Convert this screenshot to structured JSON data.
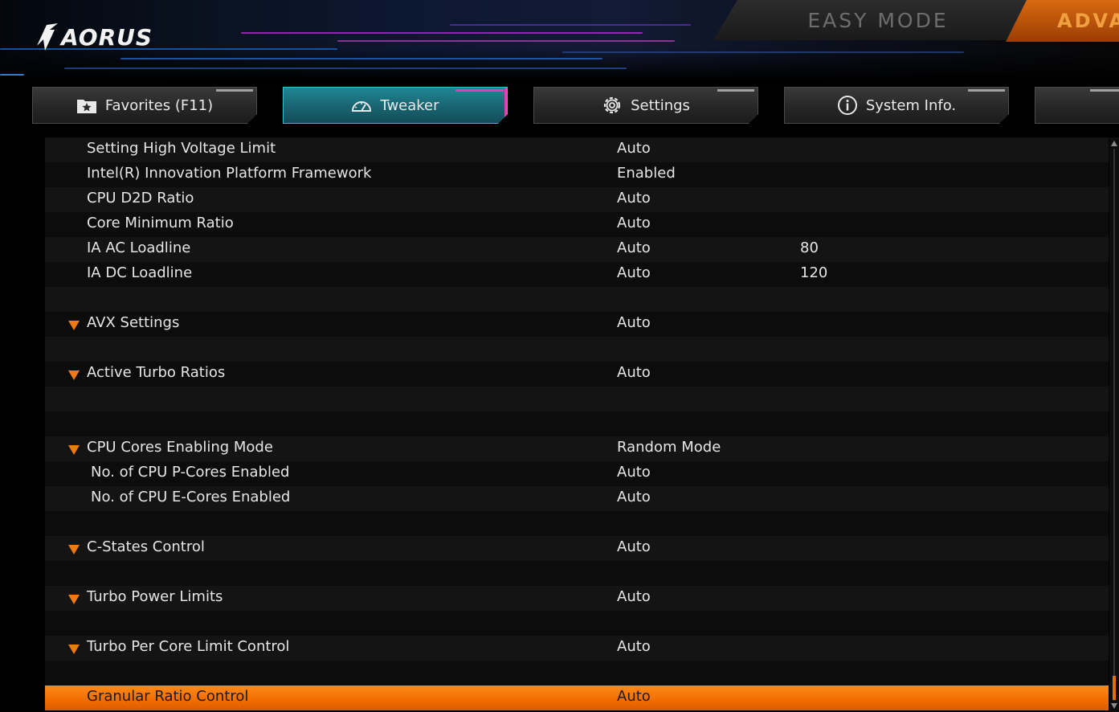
{
  "brand": {
    "logo_text": "AORUS"
  },
  "modes": {
    "easy_label": "EASY MODE",
    "advanced_label": "ADVA"
  },
  "tabs": [
    {
      "label": "Favorites (F11)",
      "icon": "star-folder-icon",
      "active": false
    },
    {
      "label": "Tweaker",
      "icon": "speedometer-icon",
      "active": true
    },
    {
      "label": "Settings",
      "icon": "gear-icon",
      "active": false
    },
    {
      "label": "System Info.",
      "icon": "info-icon",
      "active": false
    }
  ],
  "settings": [
    {
      "label": "Setting High Voltage Limit",
      "value": "Auto",
      "extra": ""
    },
    {
      "label": "Intel(R) Innovation Platform Framework",
      "value": "Enabled",
      "extra": ""
    },
    {
      "label": "CPU D2D Ratio",
      "value": "Auto",
      "extra": ""
    },
    {
      "label": "Core Minimum Ratio",
      "value": "Auto",
      "extra": ""
    },
    {
      "label": "IA AC Loadline",
      "value": "Auto",
      "extra": "80"
    },
    {
      "label": "IA DC Loadline",
      "value": "Auto",
      "extra": "120"
    },
    {
      "label": "",
      "value": "",
      "extra": ""
    },
    {
      "label": "AVX Settings",
      "value": "Auto",
      "extra": "",
      "expandable": true
    },
    {
      "label": "",
      "value": "",
      "extra": ""
    },
    {
      "label": "Active Turbo Ratios",
      "value": "Auto",
      "extra": "",
      "expandable": true
    },
    {
      "label": "",
      "value": "",
      "extra": ""
    },
    {
      "label": "",
      "value": "",
      "extra": ""
    },
    {
      "label": "CPU Cores Enabling Mode",
      "value": "Random Mode",
      "extra": "",
      "expandable": true
    },
    {
      "label": "No. of CPU P-Cores Enabled",
      "value": "Auto",
      "extra": "",
      "sub": true
    },
    {
      "label": "No. of CPU E-Cores Enabled",
      "value": "Auto",
      "extra": "",
      "sub": true
    },
    {
      "label": "",
      "value": "",
      "extra": ""
    },
    {
      "label": "C-States Control",
      "value": "Auto",
      "extra": "",
      "expandable": true
    },
    {
      "label": "",
      "value": "",
      "extra": ""
    },
    {
      "label": "Turbo Power Limits",
      "value": "Auto",
      "extra": "",
      "expandable": true
    },
    {
      "label": "",
      "value": "",
      "extra": ""
    },
    {
      "label": "Turbo Per Core Limit Control",
      "value": "Auto",
      "extra": "",
      "expandable": true
    },
    {
      "label": "",
      "value": "",
      "extra": ""
    },
    {
      "label": "Granular Ratio Control",
      "value": "Auto",
      "extra": "",
      "selected": true
    }
  ],
  "colors": {
    "accent": "#f26d00",
    "active_tab": "#1a6673",
    "active_tab_edge": "#e23fb5",
    "expand_arrow": "#f07a12"
  }
}
